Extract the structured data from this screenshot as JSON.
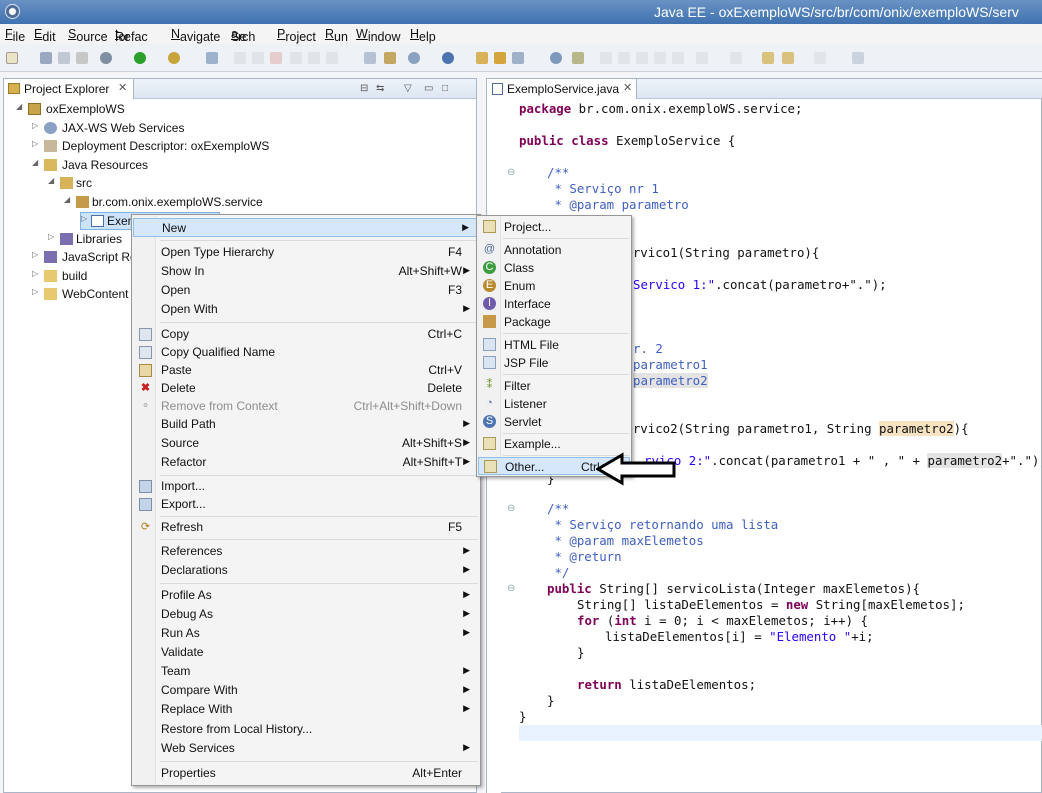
{
  "window": {
    "title": "Java EE - oxExemploWS/src/br/com/onix/exemploWS/serv"
  },
  "menubar": [
    {
      "pre": "",
      "u": "F",
      "post": "ile"
    },
    {
      "pre": "",
      "u": "E",
      "post": "dit"
    },
    {
      "pre": "",
      "u": "S",
      "post": "ource"
    },
    {
      "pre": "Refac",
      "u": "t",
      "post": "or"
    },
    {
      "pre": "",
      "u": "N",
      "post": "avigate"
    },
    {
      "pre": "Se",
      "u": "a",
      "post": "rch"
    },
    {
      "pre": "",
      "u": "P",
      "post": "roject"
    },
    {
      "pre": "",
      "u": "R",
      "post": "un"
    },
    {
      "pre": "",
      "u": "W",
      "post": "indow"
    },
    {
      "pre": "",
      "u": "H",
      "post": "elp"
    }
  ],
  "explorer": {
    "tab_label": "Project Explorer",
    "tree": [
      {
        "label": "oxExemploWS",
        "icon": "project-icon",
        "expanded": true
      },
      {
        "label": "JAX-WS Web Services",
        "icon": "webservice-icon",
        "expanded": false
      },
      {
        "label": "Deployment Descriptor: oxExemploWS",
        "icon": "descriptor-icon",
        "expanded": false
      },
      {
        "label": "Java Resources",
        "icon": "java-resources-icon",
        "expanded": true
      },
      {
        "label": "src",
        "icon": "source-folder-icon",
        "expanded": true
      },
      {
        "label": "br.com.onix.exemploWS.service",
        "icon": "package-icon",
        "expanded": true
      },
      {
        "label": "Exem",
        "icon": "java-file-icon",
        "expanded": false
      },
      {
        "label": "Libraries",
        "icon": "library-icon",
        "expanded": false
      },
      {
        "label": "JavaScript Res",
        "icon": "javascript-icon",
        "expanded": false
      },
      {
        "label": "build",
        "icon": "folder-icon",
        "expanded": false
      },
      {
        "label": "WebContent",
        "icon": "folder-icon",
        "expanded": false
      }
    ]
  },
  "editor": {
    "tab_label": "ExemploService.java",
    "code": {
      "package_kw": "package",
      "package_name": " br.com.onix.exemploWS.service;",
      "public_kw": "public",
      "class_kw": "class",
      "class_name": " ExemploService {",
      "c1_open": "/**",
      "c1_l1": " * Serviço nr 1",
      "c1_l2": " * @param parametro",
      "m1_sig_tail": "g servico1(String parametro){",
      "m1_body_tail_str": "Servico 1:\"",
      "m1_body_tail": ".concat(parametro+\".\");",
      "c2_l1": "r. 2",
      "c2_l2": "parametro1",
      "c2_l3": "parametro2",
      "m2_sig_tail": "g servico2(String parametro1, String ",
      "m2_sig_param": "parametro2",
      "m2_sig_end": "){",
      "m2_body_str": "rvico 2:\"",
      "m2_body_mid": ".concat(parametro1 + \" , \" + ",
      "m2_body_param": "parametro2",
      "m2_body_end": "+\".\");",
      "m2_close": "}",
      "c3_open": "/**",
      "c3_l1": " * Serviço retornando uma lista",
      "c3_l2": " * @param maxElemetos",
      "c3_l3": " * @return",
      "c3_close": " */",
      "l_public": "public",
      "l_sig": " String[] servicoLista(Integer maxElemetos){",
      "l_decl_a": "String[] listaDeElementos = ",
      "l_new": "new",
      "l_decl_b": " String[maxElemetos];",
      "l_for": "for",
      "l_paren": " (",
      "l_int": "int",
      "l_loop": " i = 0; i < maxElemetos; i++) {",
      "l_assign_a": "listaDeElementos[i] = ",
      "l_assign_str": "\"Elemento \"",
      "l_assign_b": "+i;",
      "l_close_for": "}",
      "l_return": "return",
      "l_return_val": " listaDeElementos;",
      "l_close_method": "}",
      "l_close_class": "}"
    }
  },
  "context_menu": {
    "items": [
      {
        "label": "New",
        "accel": "",
        "submenu": true,
        "selected": true
      },
      {
        "label": "Open Type Hierarchy",
        "accel": "F4"
      },
      {
        "label": "Show In",
        "accel": "Alt+Shift+W",
        "submenu": true
      },
      {
        "label": "Open",
        "accel": "F3"
      },
      {
        "label": "Open With",
        "accel": "",
        "submenu": true
      },
      {
        "label": "Copy",
        "accel": "Ctrl+C",
        "icon": "copy-icon"
      },
      {
        "label": "Copy Qualified Name",
        "accel": "",
        "icon": "copy-qualified-icon"
      },
      {
        "label": "Paste",
        "accel": "Ctrl+V",
        "icon": "paste-icon"
      },
      {
        "label": "Delete",
        "accel": "Delete",
        "icon": "delete-icon"
      },
      {
        "label": "Remove from Context",
        "accel": "Ctrl+Alt+Shift+Down",
        "disabled": true,
        "icon": "remove-context-icon"
      },
      {
        "label": "Build Path",
        "accel": "",
        "submenu": true
      },
      {
        "label": "Source",
        "accel": "Alt+Shift+S",
        "submenu": true
      },
      {
        "label": "Refactor",
        "accel": "Alt+Shift+T",
        "submenu": true
      },
      {
        "label": "Import...",
        "accel": "",
        "icon": "import-icon"
      },
      {
        "label": "Export...",
        "accel": "",
        "icon": "export-icon"
      },
      {
        "label": "Refresh",
        "accel": "F5",
        "icon": "refresh-icon"
      },
      {
        "label": "References",
        "accel": "",
        "submenu": true
      },
      {
        "label": "Declarations",
        "accel": "",
        "submenu": true
      },
      {
        "label": "Profile As",
        "accel": "",
        "submenu": true
      },
      {
        "label": "Debug As",
        "accel": "",
        "submenu": true
      },
      {
        "label": "Run As",
        "accel": "",
        "submenu": true
      },
      {
        "label": "Validate",
        "accel": ""
      },
      {
        "label": "Team",
        "accel": "",
        "submenu": true
      },
      {
        "label": "Compare With",
        "accel": "",
        "submenu": true
      },
      {
        "label": "Replace With",
        "accel": "",
        "submenu": true
      },
      {
        "label": "Restore from Local History...",
        "accel": ""
      },
      {
        "label": "Web Services",
        "accel": "",
        "submenu": true
      },
      {
        "label": "Properties",
        "accel": "Alt+Enter"
      }
    ]
  },
  "new_submenu": {
    "items": [
      {
        "label": "Project...",
        "icon": "new-project-icon"
      },
      {
        "label": "Annotation",
        "icon": "annotation-icon"
      },
      {
        "label": "Class",
        "icon": "class-icon"
      },
      {
        "label": "Enum",
        "icon": "enum-icon"
      },
      {
        "label": "Interface",
        "icon": "interface-icon"
      },
      {
        "label": "Package",
        "icon": "package-icon"
      },
      {
        "label": "HTML File",
        "icon": "html-file-icon"
      },
      {
        "label": "JSP File",
        "icon": "jsp-file-icon"
      },
      {
        "label": "Filter",
        "icon": "filter-icon"
      },
      {
        "label": "Listener",
        "icon": "listener-icon"
      },
      {
        "label": "Servlet",
        "icon": "servlet-icon"
      },
      {
        "label": "Example...",
        "icon": "example-icon"
      },
      {
        "label": "Other...",
        "icon": "other-icon",
        "accel": "Ctrl+N",
        "selected": true
      }
    ]
  },
  "colors": {
    "keyword": "#7f0055",
    "comment": "#3f5fbf",
    "string": "#2a00ff",
    "selection": "#d5e7f8",
    "titlebar": "#3f72b0"
  }
}
